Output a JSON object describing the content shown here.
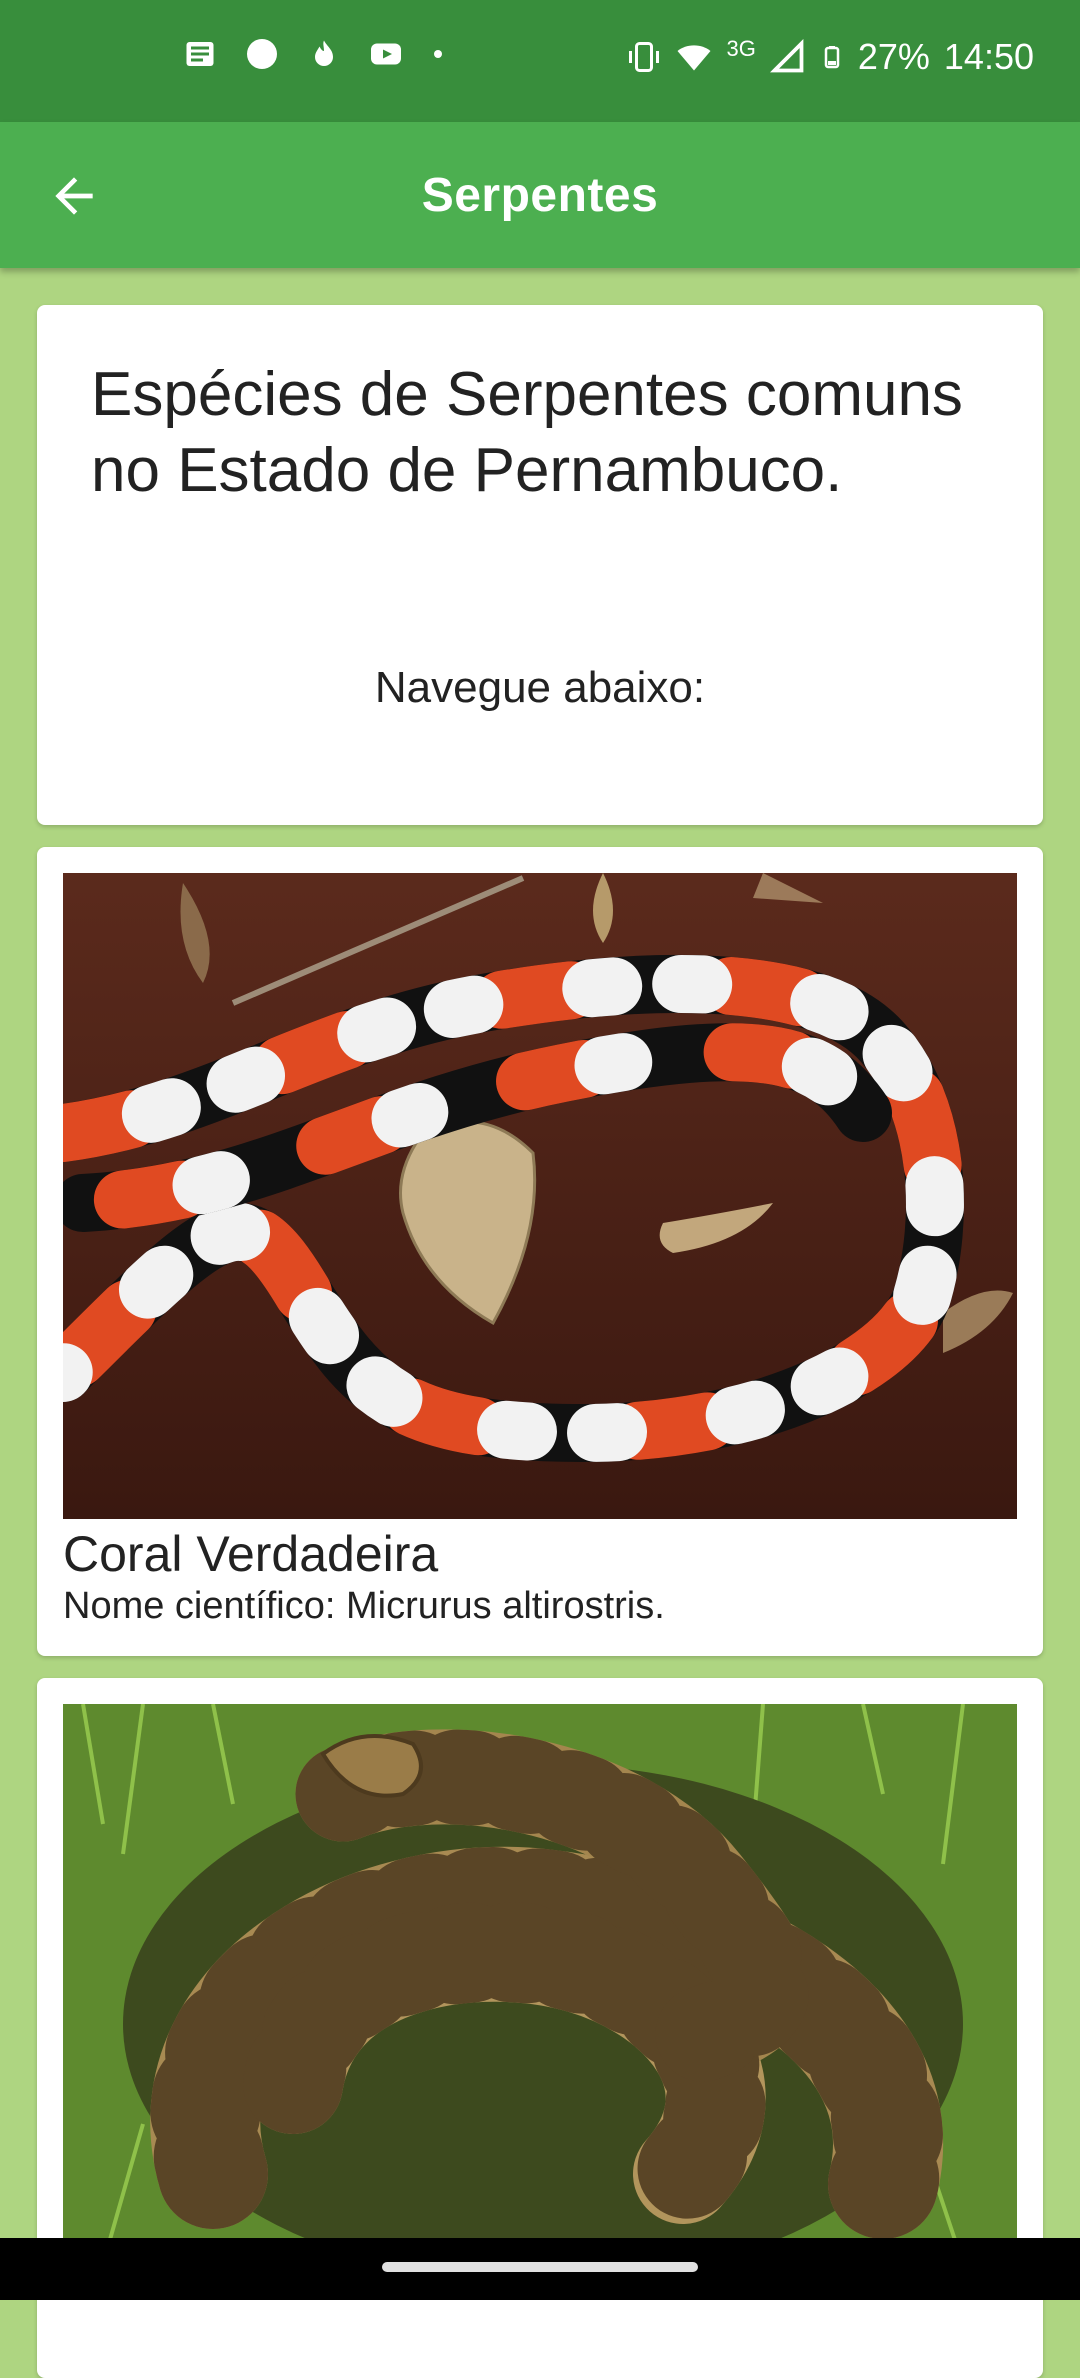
{
  "status_bar": {
    "network": "3G",
    "battery": "27%",
    "time": "14:50"
  },
  "app_bar": {
    "title": "Serpentes"
  },
  "intro": {
    "title": "Espécies de Serpentes comuns no Estado de Pernambuco.",
    "subtitle": "Navegue abaixo:"
  },
  "snakes": [
    {
      "name": "Coral Verdadeira",
      "scientific": "Nome científico: Micrurus altirostris."
    },
    {
      "name": "",
      "scientific": ""
    }
  ],
  "colors": {
    "status_bar": "#388e3c",
    "app_bar": "#4caf50",
    "background": "#aed581"
  }
}
